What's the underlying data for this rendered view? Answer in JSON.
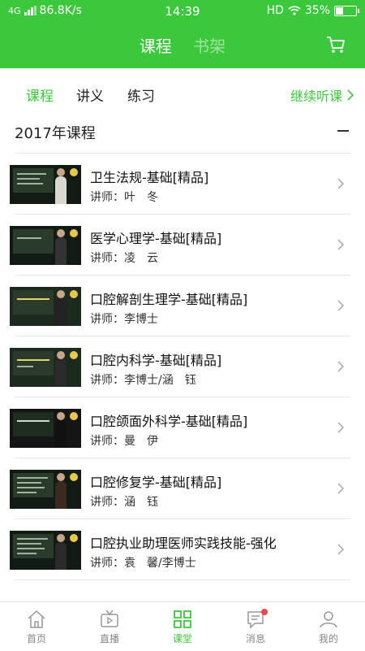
{
  "status_bar": {
    "network": "4G",
    "speed": "86.8K/s",
    "time": "14:39",
    "hd": "HD",
    "battery": "35%"
  },
  "header": {
    "tabs": [
      {
        "label": "课程",
        "active": true
      },
      {
        "label": "书架",
        "active": false
      }
    ],
    "cart_icon": "cart-icon"
  },
  "subtabs": [
    {
      "label": "课程",
      "active": true
    },
    {
      "label": "讲义",
      "active": false
    },
    {
      "label": "练习",
      "active": false
    }
  ],
  "continue_label": "继续听课",
  "section": {
    "title": "2017年课程",
    "collapse_icon": "minus-icon"
  },
  "courses": [
    {
      "title": "卫生法规-基础[精品]",
      "teacher": "讲师：叶　冬"
    },
    {
      "title": "医学心理学-基础[精品]",
      "teacher": "讲师：凌　云"
    },
    {
      "title": "口腔解剖生理学-基础[精品]",
      "teacher": "讲师：李博士"
    },
    {
      "title": "口腔内科学-基础[精品]",
      "teacher": "讲师：李博士/涵　钰"
    },
    {
      "title": "口腔颌面外科学-基础[精品]",
      "teacher": "讲师：曼　伊"
    },
    {
      "title": "口腔修复学-基础[精品]",
      "teacher": "讲师：涵　钰"
    },
    {
      "title": "口腔执业助理医师实践技能-强化",
      "teacher": "讲师：袁　馨/李博士"
    }
  ],
  "bottom_nav": [
    {
      "label": "首页",
      "icon": "home-icon",
      "active": false
    },
    {
      "label": "直播",
      "icon": "tv-icon",
      "active": false
    },
    {
      "label": "课堂",
      "icon": "grid-icon",
      "active": true
    },
    {
      "label": "消息",
      "icon": "message-icon",
      "active": false,
      "badge": true
    },
    {
      "label": "我的",
      "icon": "user-icon",
      "active": false
    }
  ],
  "colors": {
    "accent": "#3cc83c",
    "badge": "#f0474f"
  }
}
